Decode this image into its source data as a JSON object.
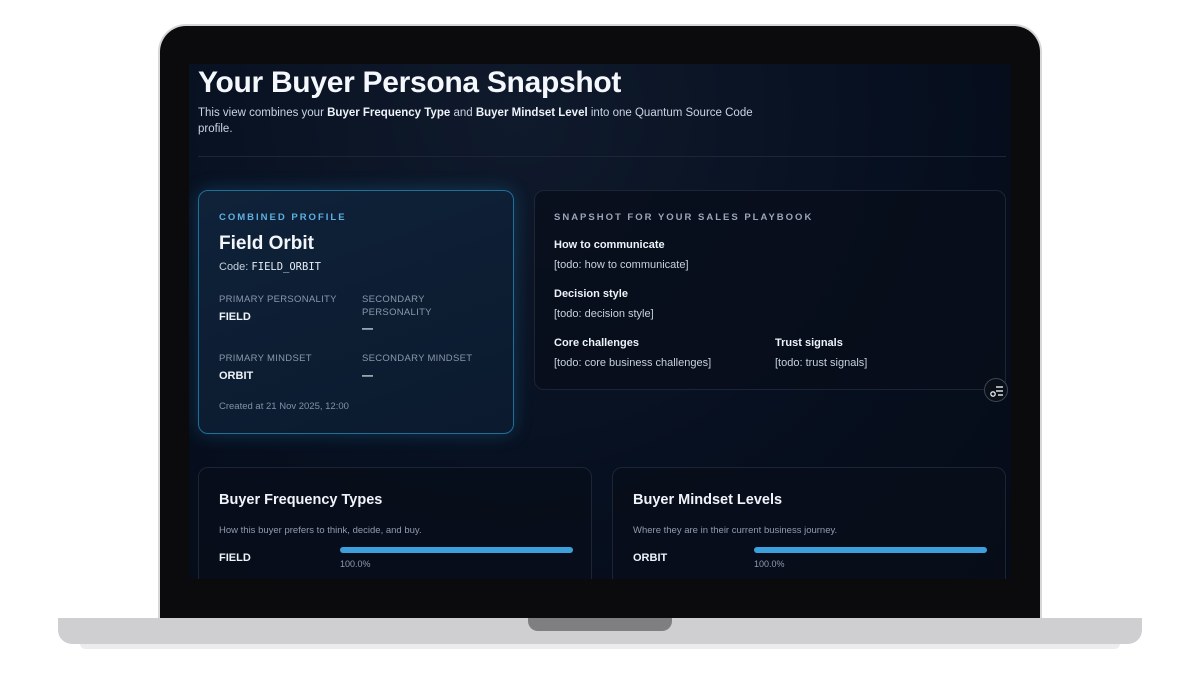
{
  "header": {
    "title": "Your Buyer Persona Snapshot",
    "desc_pre": "This view combines your ",
    "desc_b1": "Buyer Frequency Type",
    "desc_mid": " and ",
    "desc_b2": "Buyer Mindset Level",
    "desc_post": " into one Quantum Source Code profile."
  },
  "profile": {
    "eyebrow": "COMBINED PROFILE",
    "name": "Field Orbit",
    "code_label": "Code: ",
    "code_value": "FIELD_ORBIT",
    "primary_personality_label": "PRIMARY PERSONALITY",
    "primary_personality_value": "FIELD",
    "secondary_personality_label": "SECONDARY PERSONALITY",
    "secondary_personality_value": "—",
    "primary_mindset_label": "PRIMARY MINDSET",
    "primary_mindset_value": "ORBIT",
    "secondary_mindset_label": "SECONDARY MINDSET",
    "secondary_mindset_value": "—",
    "created": "Created at 21 Nov 2025, 12:00"
  },
  "playbook": {
    "eyebrow": "SNAPSHOT FOR YOUR SALES PLAYBOOK",
    "communicate_head": "How to communicate",
    "communicate_text": "[todo: how to communicate]",
    "decision_head": "Decision style",
    "decision_text": "[todo: decision style]",
    "challenges_head": "Core challenges",
    "challenges_text": "[todo: core business challenges]",
    "trust_head": "Trust signals",
    "trust_text": "[todo: trust signals]",
    "float_icon": "filter-settings-icon"
  },
  "frequency": {
    "title": "Buyer Frequency Types",
    "subtitle": "How this buyer prefers to think, decide, and buy.",
    "items": [
      {
        "label": "FIELD",
        "percent_text": "100.0%",
        "fraction": 1.0
      }
    ]
  },
  "mindset": {
    "title": "Buyer Mindset Levels",
    "subtitle": "Where they are in their current business journey.",
    "items": [
      {
        "label": "ORBIT",
        "percent_text": "100.0%",
        "fraction": 1.0
      }
    ]
  },
  "colors": {
    "accent": "#3d9fdc",
    "eyebrow": "#5fb0e0",
    "background": "#071020"
  }
}
